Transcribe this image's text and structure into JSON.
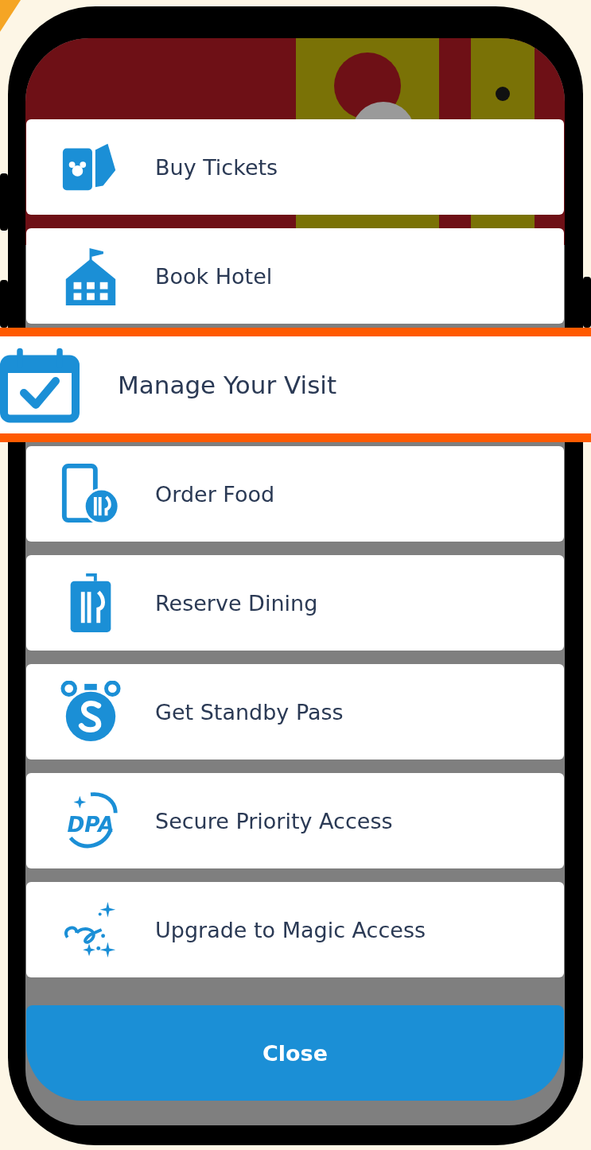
{
  "menu": {
    "items": [
      {
        "label": "Buy Tickets",
        "selected": false
      },
      {
        "label": "Book Hotel",
        "selected": false
      },
      {
        "label": "Manage Your Visit",
        "selected": true
      },
      {
        "label": "Order Food",
        "selected": false
      },
      {
        "label": "Reserve Dining",
        "selected": false
      },
      {
        "label": "Get Standby Pass",
        "selected": false
      },
      {
        "label": "Secure Priority Access",
        "selected": false,
        "icon_text": "DPA"
      },
      {
        "label": "Upgrade to Magic Access",
        "selected": false
      }
    ]
  },
  "close_button": "Close"
}
